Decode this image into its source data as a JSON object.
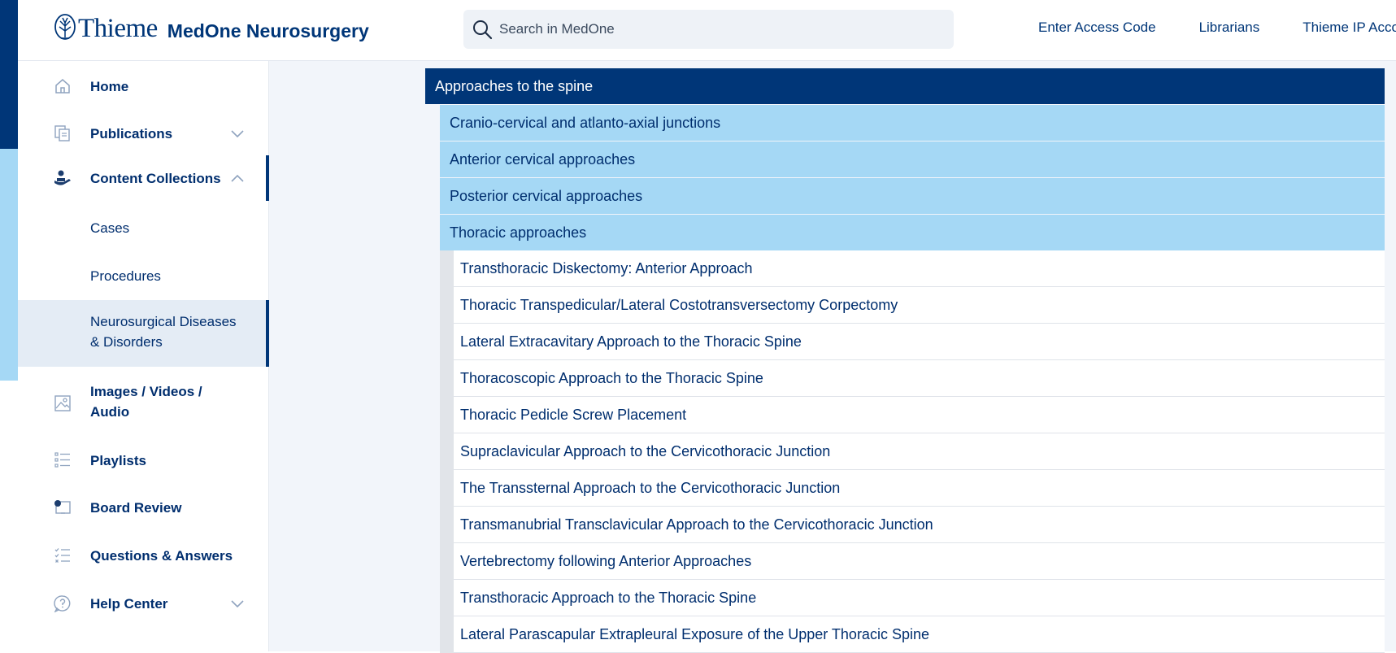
{
  "header": {
    "brand": "Thieme",
    "product": "MedOne Neurosurgery",
    "search_placeholder": "Search in MedOne",
    "links": [
      "Enter Access Code",
      "Librarians",
      "Thieme IP Account"
    ]
  },
  "sidebar": {
    "items": [
      {
        "label": "Home",
        "icon": "home-icon"
      },
      {
        "label": "Publications",
        "icon": "publications-icon",
        "expandable": true,
        "expanded": false
      },
      {
        "label": "Content Collections",
        "icon": "content-collections-icon",
        "expandable": true,
        "expanded": true
      },
      {
        "label": "Cases"
      },
      {
        "label": "Procedures"
      },
      {
        "label": "Neurosurgical Diseases & Disorders",
        "line1": "Neurosurgical Diseases",
        "line2": "& Disorders",
        "selected": true
      },
      {
        "label": "Images / Videos / Audio",
        "line1": "Images / Videos /",
        "line2": "Audio",
        "icon": "image-icon"
      },
      {
        "label": "Playlists",
        "icon": "list-icon"
      },
      {
        "label": "Board Review",
        "icon": "board-review-icon"
      },
      {
        "label": "Questions & Answers",
        "icon": "checklist-icon"
      },
      {
        "label": "Help Center",
        "icon": "help-icon",
        "expandable": true,
        "expanded": false
      }
    ]
  },
  "tree": {
    "title": "Approaches to the spine",
    "sections": [
      "Cranio-cervical and atlanto-axial junctions",
      "Anterior cervical approaches",
      "Posterior cervical approaches",
      "Thoracic approaches"
    ],
    "thoracic_items": [
      "Transthoracic Diskectomy: Anterior Approach",
      "Thoracic Transpedicular/Lateral Costotransversectomy Corpectomy",
      "Lateral Extracavitary Approach to the Thoracic Spine",
      "Thoracoscopic Approach to the Thoracic Spine",
      "Thoracic Pedicle Screw Placement",
      "Supraclavicular Approach to the Cervicothoracic Junction",
      "The Transsternal Approach to the Cervicothoracic Junction",
      "Transmanubrial Transclavicular Approach to the Cervicothoracic Junction",
      "Vertebrectomy following Anterior Approaches",
      "Transthoracic Approach to the Thoracic Spine",
      "Lateral Parascapular Extrapleural Exposure of the Upper Thoracic Spine"
    ]
  },
  "colors": {
    "brand_dark": "#003678",
    "highlight": "#a5d8f5",
    "selected_bg": "#e4ecf5",
    "page_bg": "#f2f5fa"
  }
}
